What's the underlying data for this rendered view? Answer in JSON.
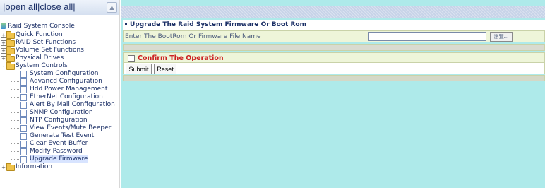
{
  "left": {
    "open_all": "open all",
    "close_all": "close all",
    "separator": "|",
    "root_label": "Raid System Console",
    "folders": [
      {
        "label": "Quick Function",
        "expander": "+"
      },
      {
        "label": "RAID Set Functions",
        "expander": "+"
      },
      {
        "label": "Volume Set Functions",
        "expander": "+"
      },
      {
        "label": "Physical Drives",
        "expander": "+"
      },
      {
        "label": "System Controls",
        "expander": "-"
      }
    ],
    "system_controls_items": [
      "System Configuration",
      "Advancd Configuration",
      "Hdd Power Management",
      "EtherNet Configuration",
      "Alert By Mail Configuration",
      "SNMP Configuration",
      "NTP Configuration",
      "View Events/Mute Beeper",
      "Generate Test Event",
      "Clear Event Buffer",
      "Modify Password",
      "Upgrade Firmware"
    ],
    "last_folder": {
      "label": "Information",
      "expander": "+"
    }
  },
  "content": {
    "title": "Upgrade The Raid System Firmware Or Boot Rom",
    "file_label": "Enter The BootRom Or Firmware File Name",
    "file_value": "",
    "browse_label": "瀏覽...",
    "confirm_label": "Confirm The Operation",
    "submit_label": "Submit",
    "reset_label": "Reset"
  },
  "colors": {
    "content_bg": "#aeeaea",
    "confirm_text": "#cc2222",
    "panel_bg": "#eef5d9"
  }
}
